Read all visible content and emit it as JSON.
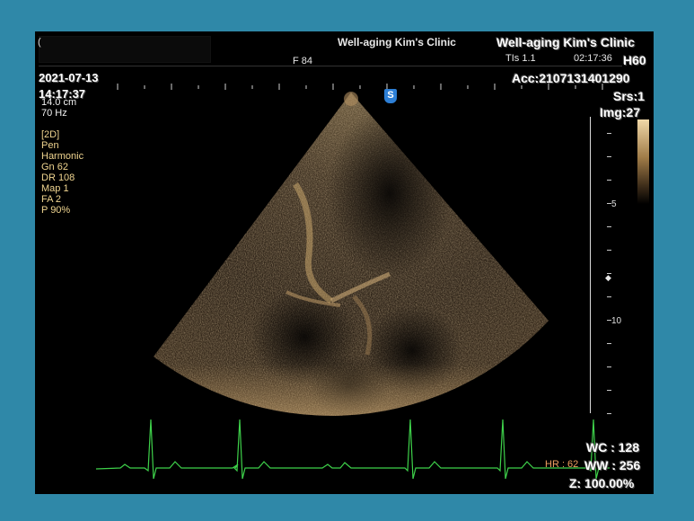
{
  "header": {
    "clinic_center": "Well-aging Kim's Clinic",
    "clinic_right": "Well-aging Kim's Clinic",
    "frame_rate": "F 84",
    "tis": "TIs  1.1",
    "time_top": "02:17:36",
    "probe": "H60",
    "date": "2021-07-13",
    "time": "14:17:37",
    "acc": "Acc:2107131401290",
    "srs": "Srs:1",
    "img": "Img:27",
    "redacted_prefix": "("
  },
  "params": {
    "depth": "14.0 cm",
    "freq": "70 Hz",
    "mode": "[2D]",
    "preset": "Pen",
    "harmonic": "Harmonic",
    "gain": "Gn  62",
    "dynamic_range": "DR  108",
    "map": "Map 1",
    "fa": "FA  2",
    "power": "P    90%"
  },
  "markers": {
    "probe_marker": "S"
  },
  "depth_scale": {
    "label_5": "5",
    "label_10": "10"
  },
  "ecg": {
    "hr": "HR : 62"
  },
  "footer": {
    "wc": "WC : 128",
    "ww": "WW : 256",
    "zoom": "Z: 100.00%"
  },
  "colors": {
    "background": "#2f88a8",
    "screen": "#000000",
    "ecg_trace": "#3ed14a",
    "param_text": "#f0d590",
    "hr_text": "#f0a060"
  }
}
